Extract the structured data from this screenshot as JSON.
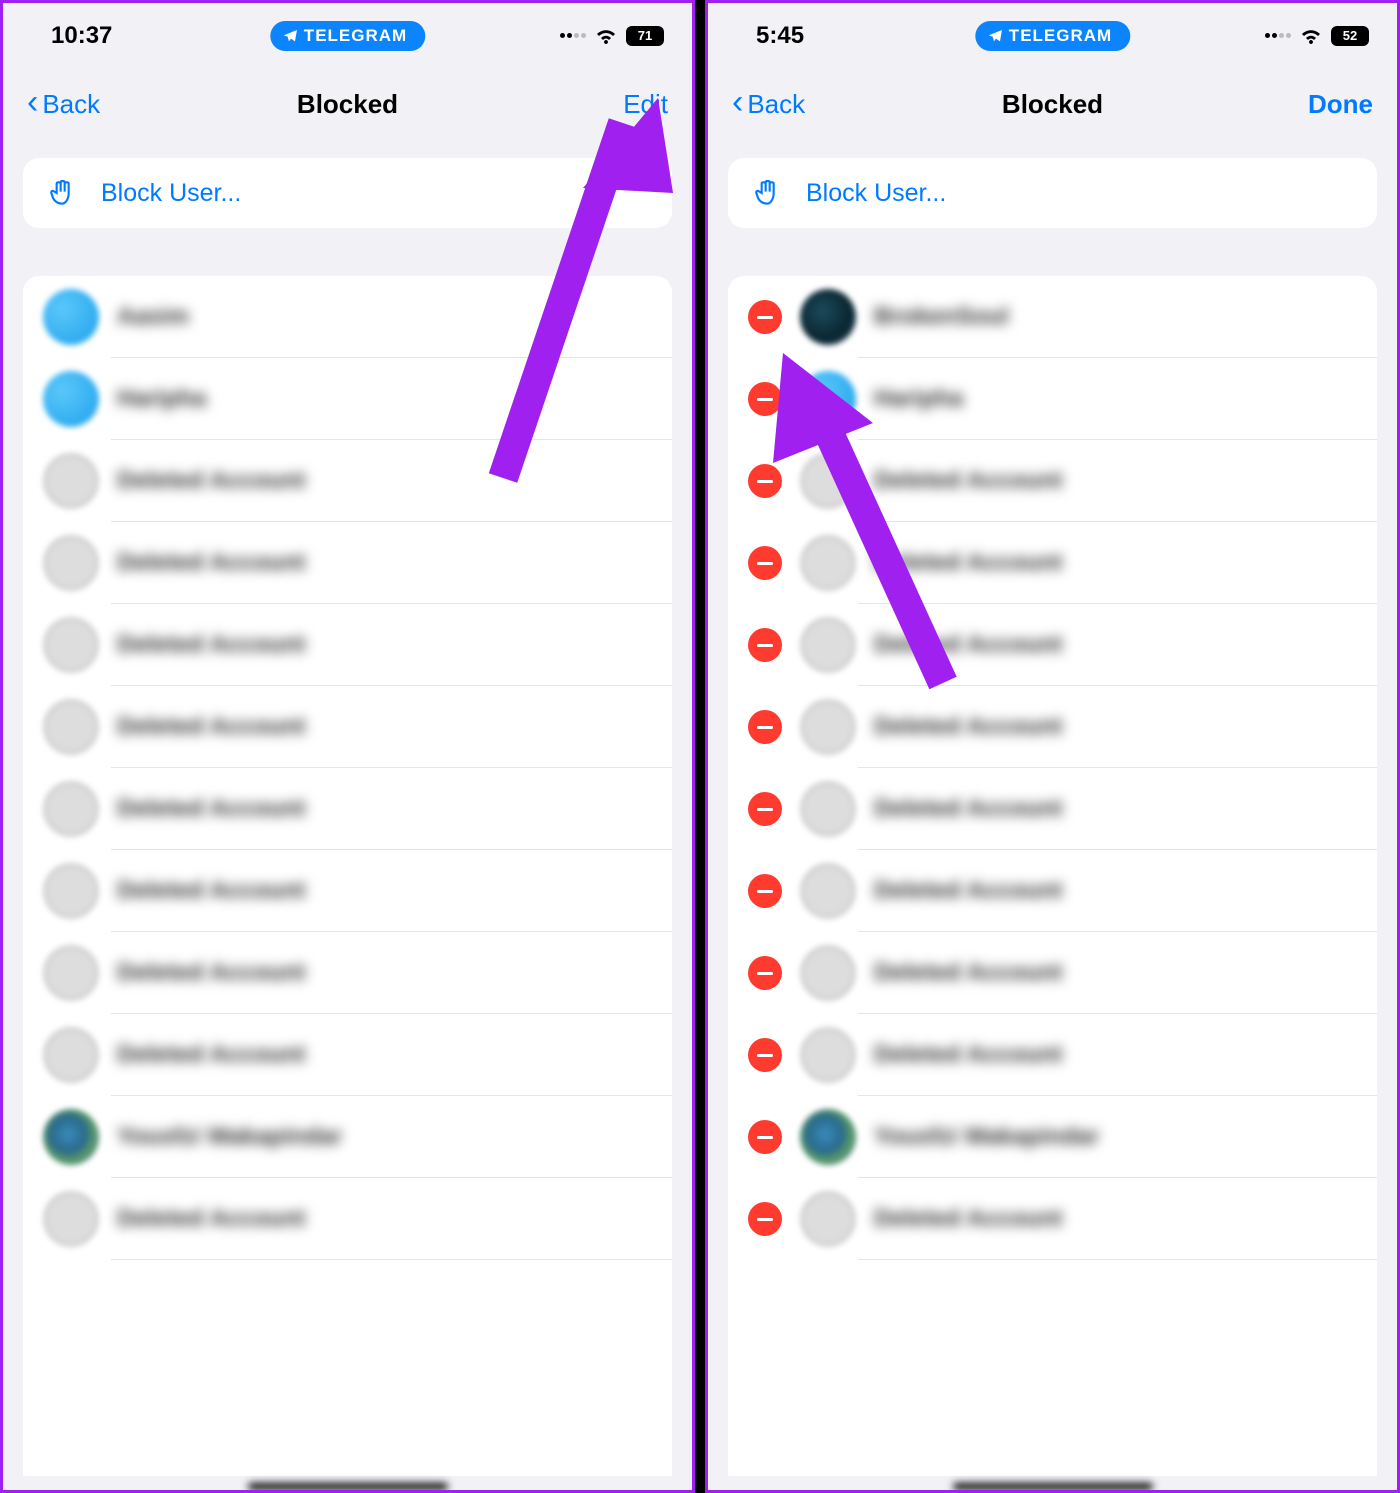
{
  "left": {
    "status": {
      "time": "10:37",
      "app_pill": "TELEGRAM",
      "battery": "71"
    },
    "nav": {
      "back": "Back",
      "title": "Blocked",
      "action": "Edit"
    },
    "block_user": "Block User...",
    "users": [
      {
        "name": "Aasim",
        "avatar": "blue"
      },
      {
        "name": "Haripha",
        "avatar": "blue"
      },
      {
        "name": "Deleted Account",
        "avatar": "gray"
      },
      {
        "name": "Deleted Account",
        "avatar": "gray"
      },
      {
        "name": "Deleted Account",
        "avatar": "gray"
      },
      {
        "name": "Deleted Account",
        "avatar": "gray"
      },
      {
        "name": "Deleted Account",
        "avatar": "gray"
      },
      {
        "name": "Deleted Account",
        "avatar": "gray"
      },
      {
        "name": "Deleted Account",
        "avatar": "gray"
      },
      {
        "name": "Deleted Account",
        "avatar": "gray"
      },
      {
        "name": "Yousfzi Wakapindar",
        "avatar": "earth"
      },
      {
        "name": "Deleted Account",
        "avatar": "gray"
      }
    ]
  },
  "right": {
    "status": {
      "time": "5:45",
      "app_pill": "TELEGRAM",
      "battery": "52"
    },
    "nav": {
      "back": "Back",
      "title": "Blocked",
      "action": "Done"
    },
    "block_user": "Block User...",
    "users": [
      {
        "name": "BrokenSoul",
        "avatar": "teal"
      },
      {
        "name": "Haripha",
        "avatar": "blue"
      },
      {
        "name": "Deleted Account",
        "avatar": "gray"
      },
      {
        "name": "Deleted Account",
        "avatar": "gray"
      },
      {
        "name": "Deleted Account",
        "avatar": "gray"
      },
      {
        "name": "Deleted Account",
        "avatar": "gray"
      },
      {
        "name": "Deleted Account",
        "avatar": "gray"
      },
      {
        "name": "Deleted Account",
        "avatar": "gray"
      },
      {
        "name": "Deleted Account",
        "avatar": "gray"
      },
      {
        "name": "Deleted Account",
        "avatar": "gray"
      },
      {
        "name": "Yousfzi Wakapindar",
        "avatar": "earth"
      },
      {
        "name": "Deleted Account",
        "avatar": "gray"
      }
    ]
  },
  "colors": {
    "accent": "#007aff",
    "arrow": "#a020f0",
    "delete": "#ff3b30"
  }
}
